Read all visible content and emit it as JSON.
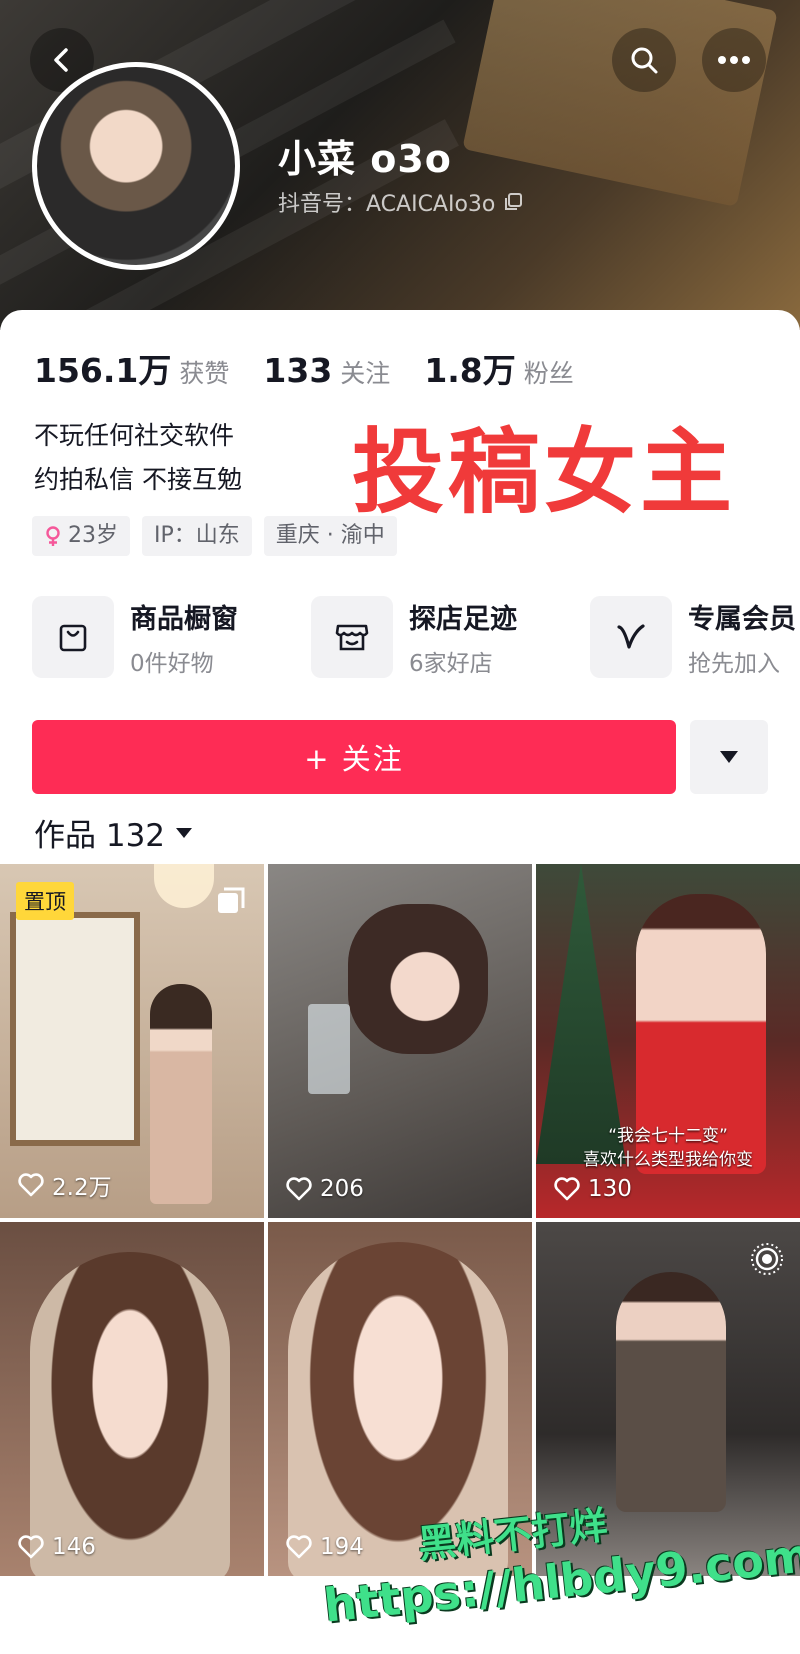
{
  "profile": {
    "name": "小菜 o3o",
    "douyin_id": "抖音号：ACAICAIo3o",
    "stats": [
      {
        "value": "156.1万",
        "label": "获赞"
      },
      {
        "value": "133",
        "label": "关注"
      },
      {
        "value": "1.8万",
        "label": "粉丝"
      }
    ],
    "bio_line1": "不玩任何社交软件",
    "bio_line2": "约拍私信 不接互勉",
    "overlay_text": "投稿女主",
    "tags": [
      "23岁",
      "IP：山东",
      "重庆 · 渝中"
    ]
  },
  "services": [
    {
      "title": "商品橱窗",
      "sub": "0件好物",
      "icon": "shopping-bag-icon"
    },
    {
      "title": "探店足迹",
      "sub": "6家好店",
      "icon": "store-icon"
    },
    {
      "title": "专属会员",
      "sub": "抢先加入",
      "icon": "vip-v-icon"
    }
  ],
  "actions": {
    "follow_label": "+ 关注"
  },
  "works": {
    "label": "作品 132"
  },
  "videos": [
    {
      "likes": "2.2万",
      "pinned": "置顶",
      "bg": "#c9b8a6"
    },
    {
      "likes": "206",
      "bg": "#6b6560"
    },
    {
      "likes": "130",
      "caption": "“我会七十二变”\n喜欢什么类型我给你变",
      "bg": "#7a2a2a"
    },
    {
      "likes": "146",
      "bg": "#8a6a58"
    },
    {
      "likes": "194",
      "bg": "#9a7a6a"
    },
    {
      "likes": "",
      "bg": "#4e4a48"
    }
  ],
  "watermark": {
    "line1": "黑料不打烊",
    "line2": "https://hlbdy9.com"
  },
  "colors": {
    "accent": "#fe2c55",
    "overlay_red": "#f03a3a",
    "pinned_yellow": "#ffd73a",
    "watermark_green": "#3fe08a"
  }
}
